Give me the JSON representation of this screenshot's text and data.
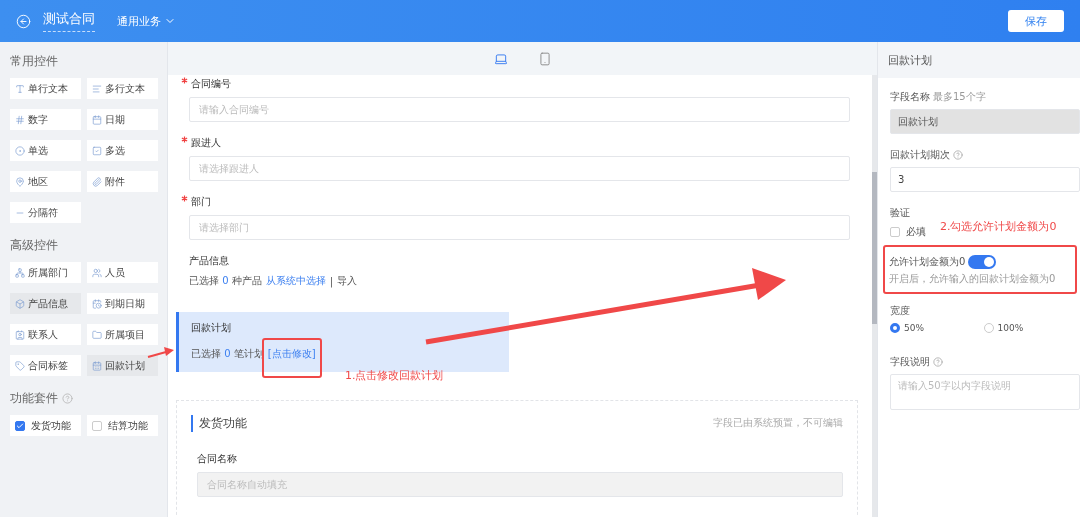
{
  "header": {
    "title": "测试合同",
    "category": "通用业务",
    "save": "保存"
  },
  "sidebar": {
    "groups": [
      {
        "title": "常用控件",
        "items": [
          {
            "label": "单行文本",
            "selected": false
          },
          {
            "label": "多行文本",
            "selected": false
          },
          {
            "label": "数字",
            "selected": false
          },
          {
            "label": "日期",
            "selected": false
          },
          {
            "label": "单选",
            "selected": false
          },
          {
            "label": "多选",
            "selected": false
          },
          {
            "label": "地区",
            "selected": false
          },
          {
            "label": "附件",
            "selected": false
          },
          {
            "label": "分隔符",
            "selected": false
          }
        ]
      },
      {
        "title": "高级控件",
        "items": [
          {
            "label": "所属部门",
            "selected": false
          },
          {
            "label": "人员",
            "selected": false
          },
          {
            "label": "产品信息",
            "selected": true
          },
          {
            "label": "到期日期",
            "selected": false
          },
          {
            "label": "联系人",
            "selected": false
          },
          {
            "label": "所属项目",
            "selected": false
          },
          {
            "label": "合同标签",
            "selected": false
          },
          {
            "label": "回款计划",
            "selected": true
          }
        ]
      }
    ],
    "suite": {
      "title": "功能套件",
      "items": [
        {
          "label": "发货功能",
          "checked": true
        },
        {
          "label": "结算功能",
          "checked": false
        }
      ]
    }
  },
  "canvas": {
    "devices": [
      {
        "selected": true
      },
      {
        "selected": false
      }
    ],
    "fields": [
      {
        "label": "合同编号",
        "required": true,
        "placeholder": "请输入合同编号"
      },
      {
        "label": "跟进人",
        "required": true,
        "placeholder": "请选择跟进人"
      },
      {
        "label": "部门",
        "required": true,
        "placeholder": "请选择部门"
      }
    ],
    "product": {
      "label": "产品信息",
      "prefix": "已选择",
      "count": "0",
      "suffix": "种产品",
      "link": "从系统中选择",
      "separator": "|",
      "import": "导入"
    },
    "payment": {
      "label": "回款计划",
      "prefix": "已选择",
      "count": "0",
      "suffix": "笔计划",
      "link": "[点击修改]",
      "selected": true
    },
    "shipping": {
      "title": "发货功能",
      "note": "字段已由系统预置，不可编辑",
      "field_label": "合同名称",
      "placeholder": "合同名称自动填充"
    }
  },
  "panel": {
    "title": "回款计划",
    "name_label": "字段名称",
    "name_hint": "最多15个字",
    "name_value": "回款计划",
    "periods_label": "回款计划期次",
    "periods_value": "3",
    "validate_label": "验证",
    "required_label": "必填",
    "required_checked": false,
    "zero_label": "允许计划金额为0",
    "zero_on": true,
    "zero_hint": "开启后，允许输入的回款计划金额为0",
    "width_label": "宽度",
    "widths": [
      {
        "label": "50%",
        "selected": true
      },
      {
        "label": "100%",
        "selected": false
      }
    ],
    "desc_label": "字段说明",
    "desc_placeholder": "请输入50字以内字段说明"
  },
  "annotations": [
    {
      "text": "1.点击修改回款计划"
    },
    {
      "text": "2.勾选允许计划金额为0"
    }
  ]
}
